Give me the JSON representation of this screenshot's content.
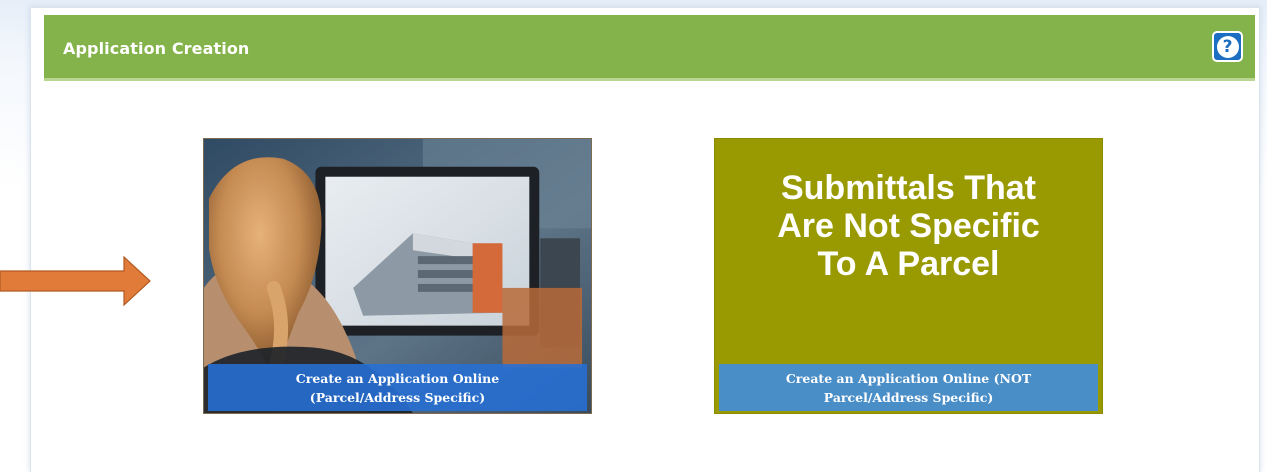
{
  "panel": {
    "title": "Application Creation",
    "help_icon": "question-mark-icon",
    "header_color": "#85b34b",
    "help_color": "#1b6ec2"
  },
  "tiles": [
    {
      "kind": "photo",
      "caption_line1": "Create an Application Online",
      "caption_line2": "(Parcel/Address Specific)"
    },
    {
      "kind": "text",
      "heading": "Submittals That Are Not Specific To A Parcel",
      "caption_line1": "Create an Application Online (NOT",
      "caption_line2": "Parcel/Address Specific)",
      "background": "#999a02"
    }
  ],
  "annotation": {
    "arrow_icon": "right-arrow-icon",
    "arrow_color": "#e07b39"
  }
}
